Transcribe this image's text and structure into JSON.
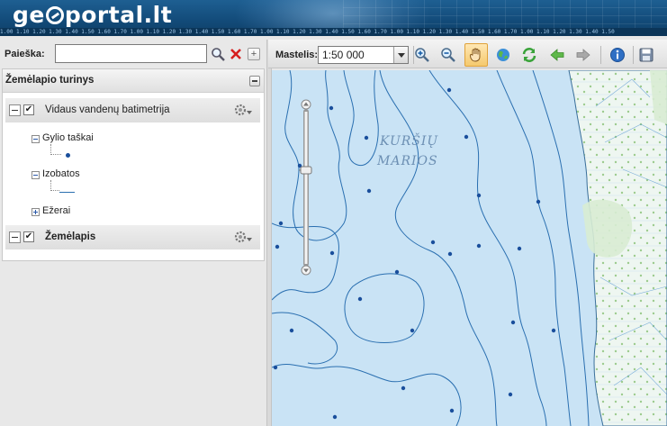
{
  "header": {
    "logo_prefix": "ge",
    "logo_suffix": "portal.lt",
    "ruler_text": "1.00 1.10 1.20 1.30 1.40 1.50 1.60 1.70 1.00 1.10 1.20 1.30 1.40 1.50 1.60 1.70 1.00 1.10 1.20 1.30 1.40 1.50 1.60 1.70 1.00 1.10 1.20 1.30 1.40 1.50 1.60 1.70 1.00 1.10 1.20 1.30 1.40 1.50"
  },
  "search": {
    "label": "Paieška:",
    "value": "",
    "placeholder": ""
  },
  "layers_panel": {
    "title": "Žemėlapio turinys",
    "layers": [
      {
        "label": "Vidaus vandenų batimetrija",
        "checked": "✔",
        "children": [
          {
            "label": "Gylio taškai"
          },
          {
            "label": "Izobatos"
          },
          {
            "label": "Ežerai"
          }
        ]
      },
      {
        "label": "Žemėlapis",
        "checked": "✔"
      }
    ]
  },
  "toolbar": {
    "scale_label": "Mastelis:",
    "scale_value": "1:50 000",
    "tools": [
      "zoom-in-icon",
      "zoom-out-icon",
      "pan-hand-icon",
      "globe-icon",
      "refresh-icon",
      "back-arrow-icon",
      "forward-arrow-icon",
      "info-icon",
      "save-icon"
    ],
    "active_tool": "pan-hand-icon"
  },
  "map": {
    "water_label_line1": "KURŠIŲ",
    "water_label_line2": "MARIOS",
    "colors": {
      "water": "#c9e3f5",
      "contour": "#2a6fb0",
      "depth_point": "#1a4f9c",
      "land": "#eef6f1",
      "forest": "#dcefd8"
    }
  }
}
